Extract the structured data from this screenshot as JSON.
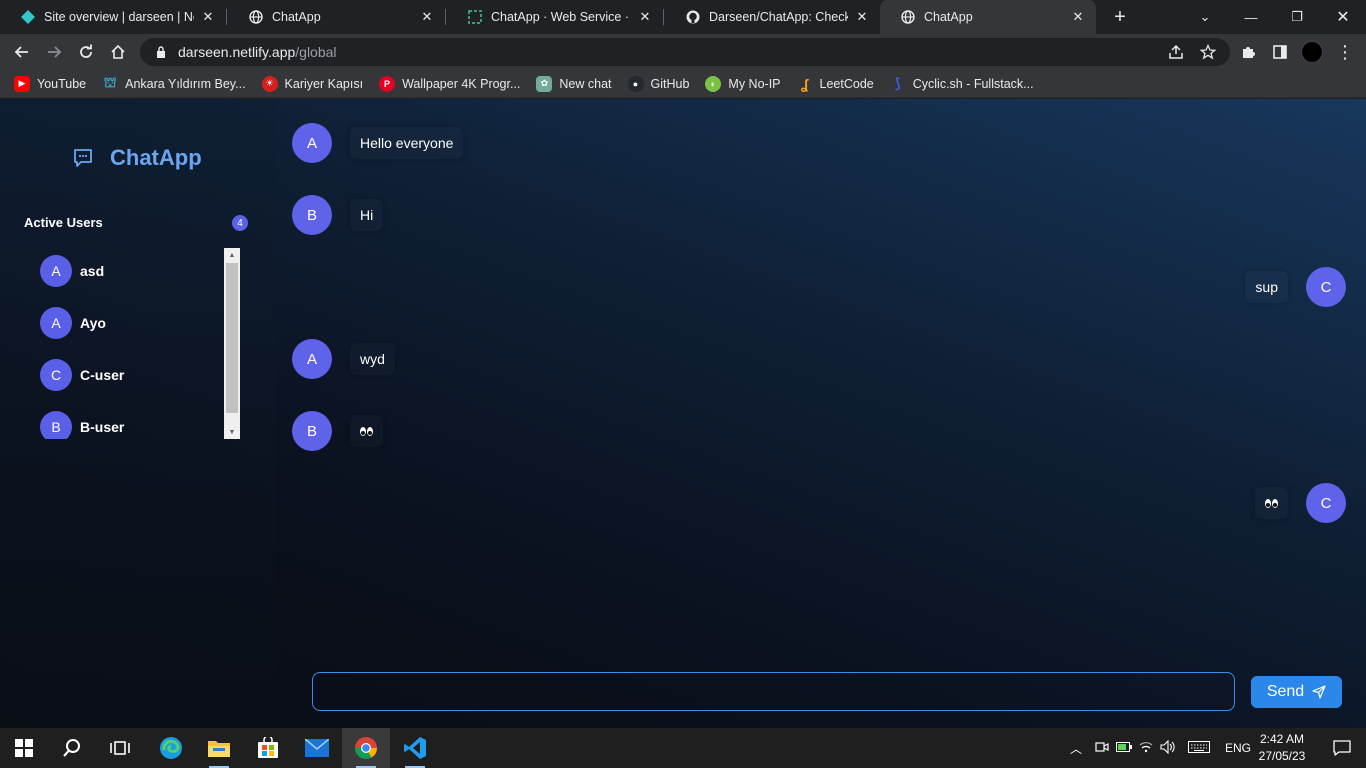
{
  "browser": {
    "tabs": [
      {
        "title": "Site overview | darseen | Netlify",
        "icon": "netlify-icon",
        "active": false
      },
      {
        "title": "ChatApp",
        "icon": "globe-icon",
        "active": false
      },
      {
        "title": "ChatApp · Web Service · Render",
        "icon": "render-icon",
        "active": false
      },
      {
        "title": "Darseen/ChatApp: Check out the",
        "icon": "github-icon",
        "active": false
      },
      {
        "title": "ChatApp",
        "icon": "globe-icon",
        "active": true
      }
    ],
    "url_host": "darseen.netlify.app",
    "url_path": "/global",
    "bookmarks": [
      {
        "label": "YouTube",
        "icon": "youtube-icon",
        "color": "#ff0000"
      },
      {
        "label": "Ankara Yıldırım Bey...",
        "icon": "university-icon",
        "color": "#3aa3c9"
      },
      {
        "label": "Kariyer Kapısı",
        "icon": "kariyer-icon",
        "color": "#d6201f"
      },
      {
        "label": "Wallpaper 4K Progr...",
        "icon": "pinterest-icon",
        "color": "#e60023"
      },
      {
        "label": "New chat",
        "icon": "openai-icon",
        "color": "#74aa9c"
      },
      {
        "label": "GitHub",
        "icon": "github-icon",
        "color": "#24292f"
      },
      {
        "label": "My No-IP",
        "icon": "noip-icon",
        "color": "#7cc242"
      },
      {
        "label": "LeetCode",
        "icon": "leetcode-icon",
        "color": "#f89f1b"
      },
      {
        "label": "Cyclic.sh - Fullstack...",
        "icon": "cyclic-icon",
        "color": "#3b5bdb"
      }
    ]
  },
  "app": {
    "brand": "ChatApp",
    "active_users_title": "Active Users",
    "active_users_count": "4",
    "users": [
      {
        "initial": "A",
        "name": "asd"
      },
      {
        "initial": "A",
        "name": "Ayo"
      },
      {
        "initial": "C",
        "name": "C-user"
      },
      {
        "initial": "B",
        "name": "B-user"
      }
    ],
    "messages": [
      {
        "initial": "A",
        "text": "Hello everyone",
        "side": "left"
      },
      {
        "initial": "B",
        "text": "Hi",
        "side": "left"
      },
      {
        "initial": "C",
        "text": "sup",
        "side": "right"
      },
      {
        "initial": "A",
        "text": "wyd",
        "side": "left"
      },
      {
        "initial": "B",
        "text": "👀",
        "side": "left"
      },
      {
        "initial": "C",
        "text": "👀",
        "side": "right"
      }
    ],
    "composer_value": "",
    "send_label": "Send",
    "accent": "#5b63e8",
    "send_color": "#2b87ea"
  },
  "taskbar": {
    "language": "ENG",
    "time": "2:42 AM",
    "date": "27/05/23"
  }
}
